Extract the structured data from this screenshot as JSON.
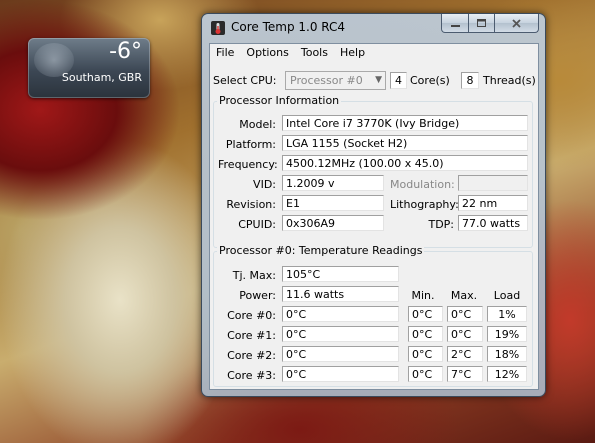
{
  "gadget": {
    "temperature": "-6°",
    "location": "Southam, GBR"
  },
  "window": {
    "title": "Core Temp 1.0 RC4",
    "menu": [
      "File",
      "Options",
      "Tools",
      "Help"
    ]
  },
  "cpu_select": {
    "label": "Select CPU:",
    "selected": "Processor #0",
    "cores_value": "4",
    "cores_label": "Core(s)",
    "threads_value": "8",
    "threads_label": "Thread(s)"
  },
  "processor_info": {
    "group_title": "Processor Information",
    "model_label": "Model:",
    "model": "Intel Core i7 3770K (Ivy Bridge)",
    "platform_label": "Platform:",
    "platform": "LGA 1155 (Socket H2)",
    "frequency_label": "Frequency:",
    "frequency": "4500.12MHz (100.00 x 45.0)",
    "vid_label": "VID:",
    "vid": "1.2009 v",
    "modulation_label": "Modulation:",
    "modulation": "",
    "revision_label": "Revision:",
    "revision": "E1",
    "lithography_label": "Lithography:",
    "lithography": "22 nm",
    "cpuid_label": "CPUID:",
    "cpuid": "0x306A9",
    "tdp_label": "TDP:",
    "tdp": "77.0 watts"
  },
  "temps": {
    "group_title": "Processor #0: Temperature Readings",
    "tjmax_label": "Tj. Max:",
    "tjmax": "105°C",
    "power_label": "Power:",
    "power": "11.6 watts",
    "col_min": "Min.",
    "col_max": "Max.",
    "col_load": "Load",
    "cores": [
      {
        "label": "Core #0:",
        "temp": "0°C",
        "min": "0°C",
        "max": "0°C",
        "load": "1%"
      },
      {
        "label": "Core #1:",
        "temp": "0°C",
        "min": "0°C",
        "max": "0°C",
        "load": "19%"
      },
      {
        "label": "Core #2:",
        "temp": "0°C",
        "min": "0°C",
        "max": "2°C",
        "load": "18%"
      },
      {
        "label": "Core #3:",
        "temp": "0°C",
        "min": "0°C",
        "max": "7°C",
        "load": "12%"
      }
    ]
  }
}
